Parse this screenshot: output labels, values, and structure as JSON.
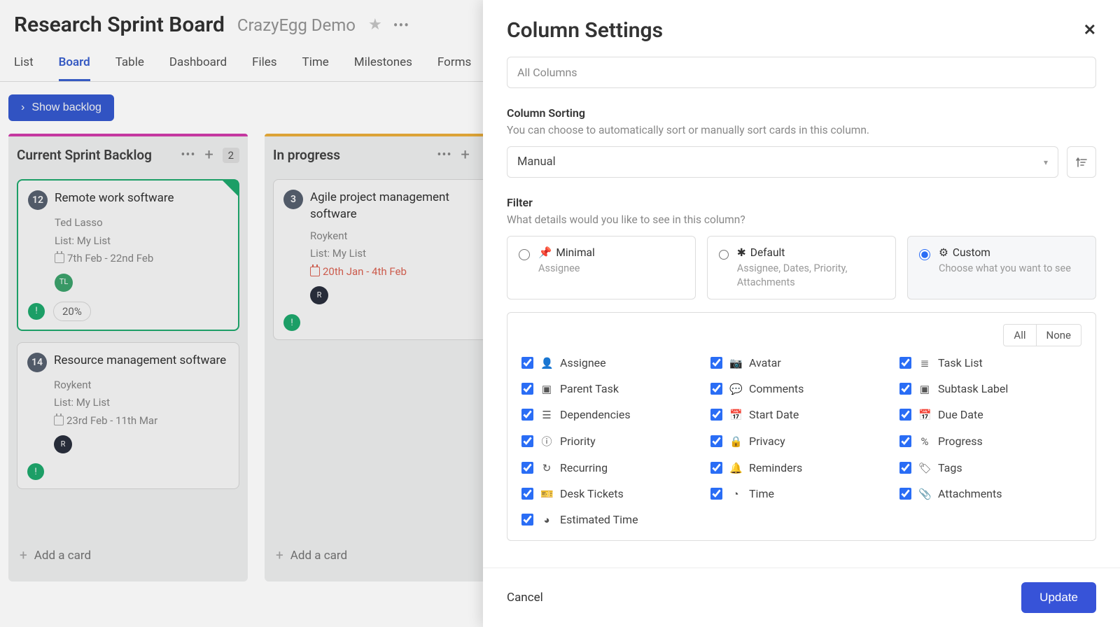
{
  "header": {
    "title": "Research Sprint Board",
    "subtitle": "CrazyEgg Demo"
  },
  "tabs": [
    "List",
    "Board",
    "Table",
    "Dashboard",
    "Files",
    "Time",
    "Milestones",
    "Forms"
  ],
  "active_tab": "Board",
  "toolbar": {
    "backlog_label": "Show backlog"
  },
  "columns": [
    {
      "title": "Current Sprint Backlog",
      "count": "2",
      "bar": "#d83fb0",
      "cards": [
        {
          "num": "12",
          "title": "Remote work software",
          "assignee": "Ted Lasso",
          "list": "List: My List",
          "dates": "7th Feb - 22nd Feb",
          "avatar": "TL",
          "av_class": "av-green",
          "selected": true,
          "pct": "20%"
        },
        {
          "num": "14",
          "title": "Resource management software",
          "assignee": "Roykent",
          "list": "List: My List",
          "dates": "23rd Feb - 11th Mar",
          "avatar": "R",
          "av_class": "av-dark",
          "selected": false
        }
      ]
    },
    {
      "title": "In progress",
      "count": "",
      "bar": "#f2b33c",
      "cards": [
        {
          "num": "3",
          "title": "Agile project management software",
          "assignee": "Roykent",
          "list": "List: My List",
          "dates": "20th Jan - 4th Feb",
          "avatar": "R",
          "av_class": "av-dark",
          "overdue": true
        }
      ]
    }
  ],
  "add_card_label": "Add a card",
  "panel": {
    "title": "Column Settings",
    "columns_select": "All Columns",
    "sorting": {
      "label": "Column Sorting",
      "hint": "You can choose to automatically sort or manually sort cards in this column.",
      "value": "Manual"
    },
    "filter": {
      "label": "Filter",
      "hint": "What details would you like to see in this column?",
      "options": [
        {
          "icon": "📌",
          "title": "Minimal",
          "sub": "Assignee",
          "checked": false
        },
        {
          "icon": "✱",
          "title": "Default",
          "sub": "Assignee, Dates, Priority, Attachments",
          "checked": false
        },
        {
          "icon": "⚙",
          "title": "Custom",
          "sub": "Choose what you want to see",
          "checked": true
        }
      ],
      "all": "All",
      "none": "None",
      "fields": [
        {
          "icon": "👤",
          "label": "Assignee"
        },
        {
          "icon": "📷",
          "label": "Avatar"
        },
        {
          "icon": "≣",
          "label": "Task List"
        },
        {
          "icon": "▣",
          "label": "Parent Task"
        },
        {
          "icon": "💬",
          "label": "Comments"
        },
        {
          "icon": "▣",
          "label": "Subtask Label"
        },
        {
          "icon": "☰",
          "label": "Dependencies"
        },
        {
          "icon": "📅",
          "label": "Start Date"
        },
        {
          "icon": "📅",
          "label": "Due Date"
        },
        {
          "icon": "ⓘ",
          "label": "Priority"
        },
        {
          "icon": "🔒",
          "label": "Privacy"
        },
        {
          "icon": "%",
          "label": "Progress"
        },
        {
          "icon": "↻",
          "label": "Recurring"
        },
        {
          "icon": "🔔",
          "label": "Reminders"
        },
        {
          "icon": "🏷",
          "label": "Tags"
        },
        {
          "icon": "🎫",
          "label": "Desk Tickets"
        },
        {
          "icon": "◔",
          "label": "Time"
        },
        {
          "icon": "📎",
          "label": "Attachments"
        },
        {
          "icon": "◕",
          "label": "Estimated Time"
        }
      ]
    },
    "cancel": "Cancel",
    "update": "Update"
  }
}
